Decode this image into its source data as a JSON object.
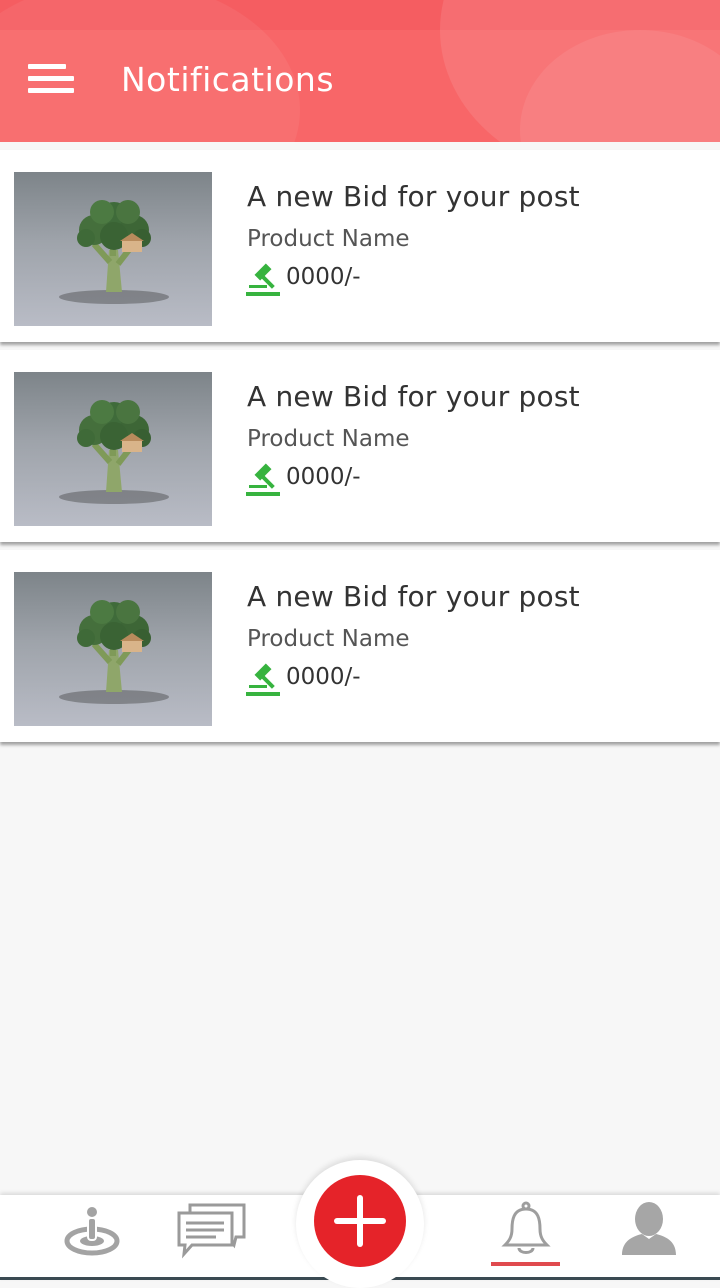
{
  "header": {
    "title": "Notifications",
    "menu_icon": "hamburger-menu-icon",
    "background_color": "#f86668"
  },
  "notifications": [
    {
      "title": "A new Bid for your post",
      "product_name": "Product Name",
      "amount": "0000/-",
      "icon": "gavel-icon"
    },
    {
      "title": "A new Bid for your post",
      "product_name": "Product Name",
      "amount": "0000/-",
      "icon": "gavel-icon"
    },
    {
      "title": "A new Bid for your post",
      "product_name": "Product Name",
      "amount": "0000/-",
      "icon": "gavel-icon"
    }
  ],
  "bottom_nav": {
    "items": [
      {
        "icon": "location-pin-icon",
        "active": false
      },
      {
        "icon": "chat-icon",
        "active": false
      },
      {
        "icon": "add-icon",
        "active": false
      },
      {
        "icon": "bell-icon",
        "active": true
      },
      {
        "icon": "profile-icon",
        "active": false
      }
    ],
    "fab_color": "#e52329",
    "active_color": "#e04a4e"
  },
  "colors": {
    "gavel": "#37b33f",
    "text_primary": "#333333"
  }
}
